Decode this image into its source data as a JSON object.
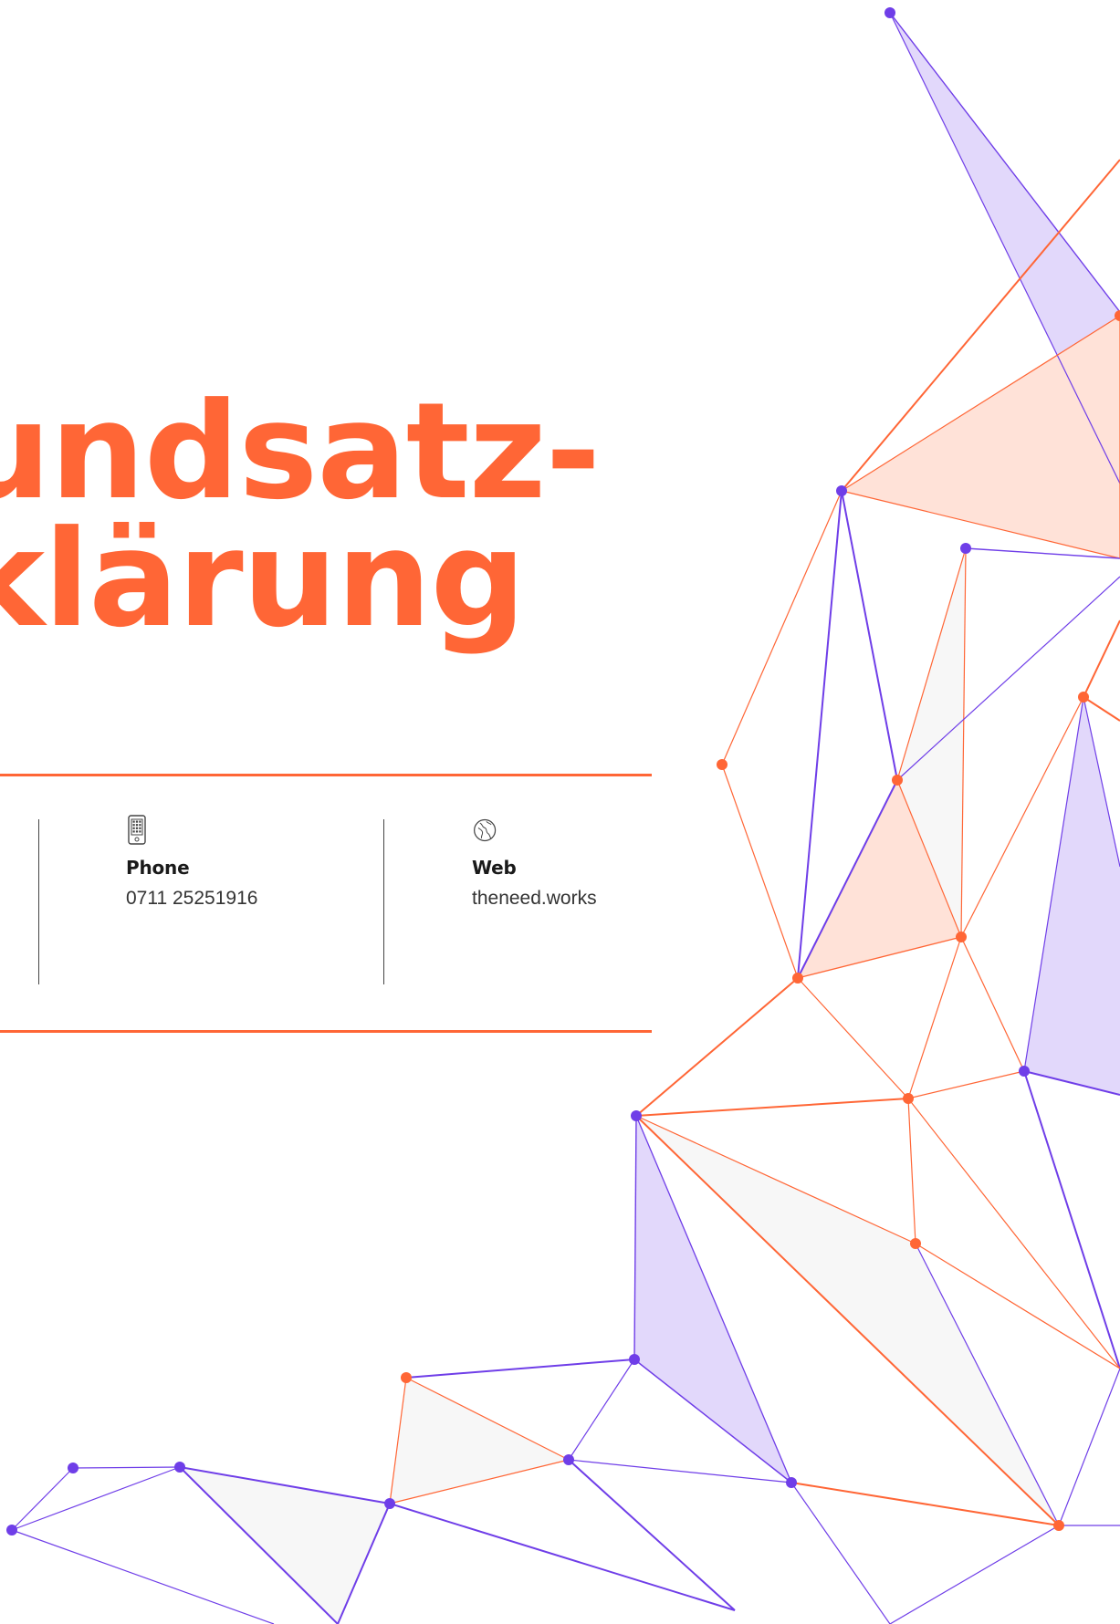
{
  "title": {
    "line1": "undsatz-",
    "line2": "klärung"
  },
  "contacts": [
    {
      "label": "Phone",
      "value": "0711 25251916",
      "icon": "mobile-phone-icon"
    },
    {
      "label": "Web",
      "value": "theneed.works",
      "icon": "globe-icon"
    }
  ],
  "colors": {
    "accent_orange": "#ff6636",
    "accent_purple": "#6f3ee8",
    "purple_fill": "#e2d8fb",
    "orange_fill": "#ffe2d8",
    "gray_fill": "#f7f7f7"
  }
}
